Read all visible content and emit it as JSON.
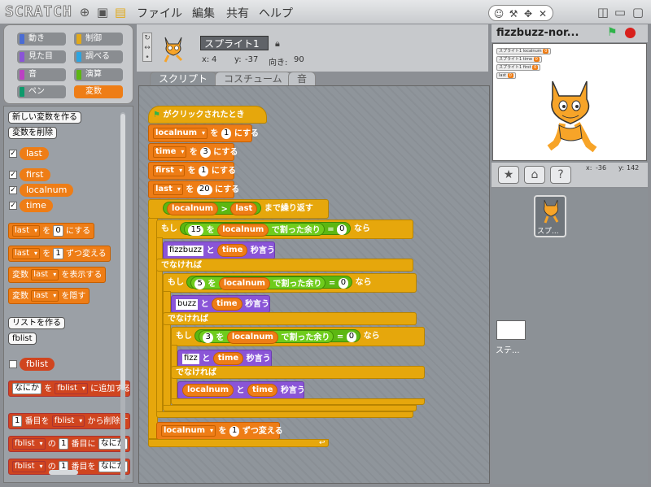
{
  "topbar": {
    "logo": "SCRATCH",
    "menus": [
      "ファイル",
      "編集",
      "共有",
      "ヘルプ"
    ]
  },
  "categories": [
    {
      "label": "動き",
      "color": "#4a6cd4"
    },
    {
      "label": "制御",
      "color": "#e1a91a"
    },
    {
      "label": "見た目",
      "color": "#8a55d7"
    },
    {
      "label": "調べる",
      "color": "#2ca5e2"
    },
    {
      "label": "音",
      "color": "#bb42c3"
    },
    {
      "label": "演算",
      "color": "#5cb712"
    },
    {
      "label": "ペン",
      "color": "#0e9a6c"
    },
    {
      "label": "変数",
      "color": "#ee7d16"
    }
  ],
  "palette": {
    "new_var": "新しい変数を作る",
    "del_var": "変数を削除",
    "vars": [
      "last",
      "first",
      "localnum",
      "time"
    ],
    "set_var": "last",
    "set_to": "を",
    "set_val": "0",
    "set_end": "にする",
    "change_var": "last",
    "change_to": "を",
    "change_val": "1",
    "change_end": "ずつ変える",
    "show_lbl": "変数",
    "show_var": "last",
    "show_end": "を表示する",
    "hide_lbl": "変数",
    "hide_var": "last",
    "hide_end": "を隠す",
    "new_list": "リストを作る",
    "del_list": "fblist",
    "list_name": "fblist",
    "add_item": "なにか",
    "add_to": "を",
    "add_list": "fblist",
    "add_end": "に追加する",
    "del_idx": "1",
    "del_mid": "番目を",
    "del_end": "から削除す",
    "ins_list": "fblist",
    "ins_no": "の",
    "ins_idx": "1",
    "ins_mid": "番目に",
    "ins_item": "なにか",
    "rep_list": "fblist",
    "rep_no": "の",
    "rep_idx": "1",
    "rep_mid": "番目を",
    "rep_item": "なにか"
  },
  "sprite": {
    "name": "スプライト1",
    "x_label": "x:",
    "x": "4",
    "y_label": "y:",
    "y": "-37",
    "dir_label": "向き:",
    "dir": "90"
  },
  "tabs": [
    "スクリプト",
    "コスチューム",
    "音"
  ],
  "script": {
    "hat": "がクリックされたとき",
    "s1": {
      "var": "localnum",
      "to": "を",
      "val": "1",
      "end": "にする"
    },
    "s2": {
      "var": "time",
      "to": "を",
      "val": "3",
      "end": "にする"
    },
    "s3": {
      "var": "first",
      "to": "を",
      "val": "1",
      "end": "にする"
    },
    "s4": {
      "var": "last",
      "to": "を",
      "val": "20",
      "end": "にする"
    },
    "repeat": {
      "a": "localnum",
      "op": ">",
      "b": "last",
      "end": "まで繰り返す"
    },
    "if1": {
      "kw": "もし",
      "n": "15",
      "wo": "を",
      "var": "localnum",
      "mod": "で割った余り",
      "eq": "=",
      "z": "0",
      "nara": "なら"
    },
    "say1": {
      "txt": "fizzbuzz",
      "to": "と",
      "var": "time",
      "end": "秒言う"
    },
    "else": "でなければ",
    "if2": {
      "kw": "もし",
      "n": "5",
      "wo": "を",
      "var": "localnum",
      "mod": "で割った余り",
      "eq": "=",
      "z": "0",
      "nara": "なら"
    },
    "say2": {
      "txt": "buzz",
      "to": "と",
      "var": "time",
      "end": "秒言う"
    },
    "if3": {
      "kw": "もし",
      "n": "3",
      "wo": "を",
      "var": "localnum",
      "mod": "で割った余り",
      "eq": "=",
      "z": "0",
      "nara": "なら"
    },
    "say3": {
      "txt": "fizz",
      "to": "と",
      "var": "time",
      "end": "秒言う"
    },
    "say4": {
      "var1": "localnum",
      "to": "と",
      "var": "time",
      "end": "秒言う"
    },
    "chg": {
      "var": "localnum",
      "to": "を",
      "val": "1",
      "end": "ずつ変える"
    }
  },
  "stage": {
    "title": "fizzbuzz-nor...",
    "monitors": [
      {
        "l": "スプライト1 localnum",
        "v": "0"
      },
      {
        "l": "スプライト1 time",
        "v": "0"
      },
      {
        "l": "スプライト1 first",
        "v": "0"
      },
      {
        "l": "last",
        "v": "0"
      }
    ],
    "mx_label": "x:",
    "mx": "-36",
    "my_label": "y:",
    "my": "142"
  },
  "sprite_list": {
    "sprite": "スプ...",
    "stage": "ステ..."
  }
}
